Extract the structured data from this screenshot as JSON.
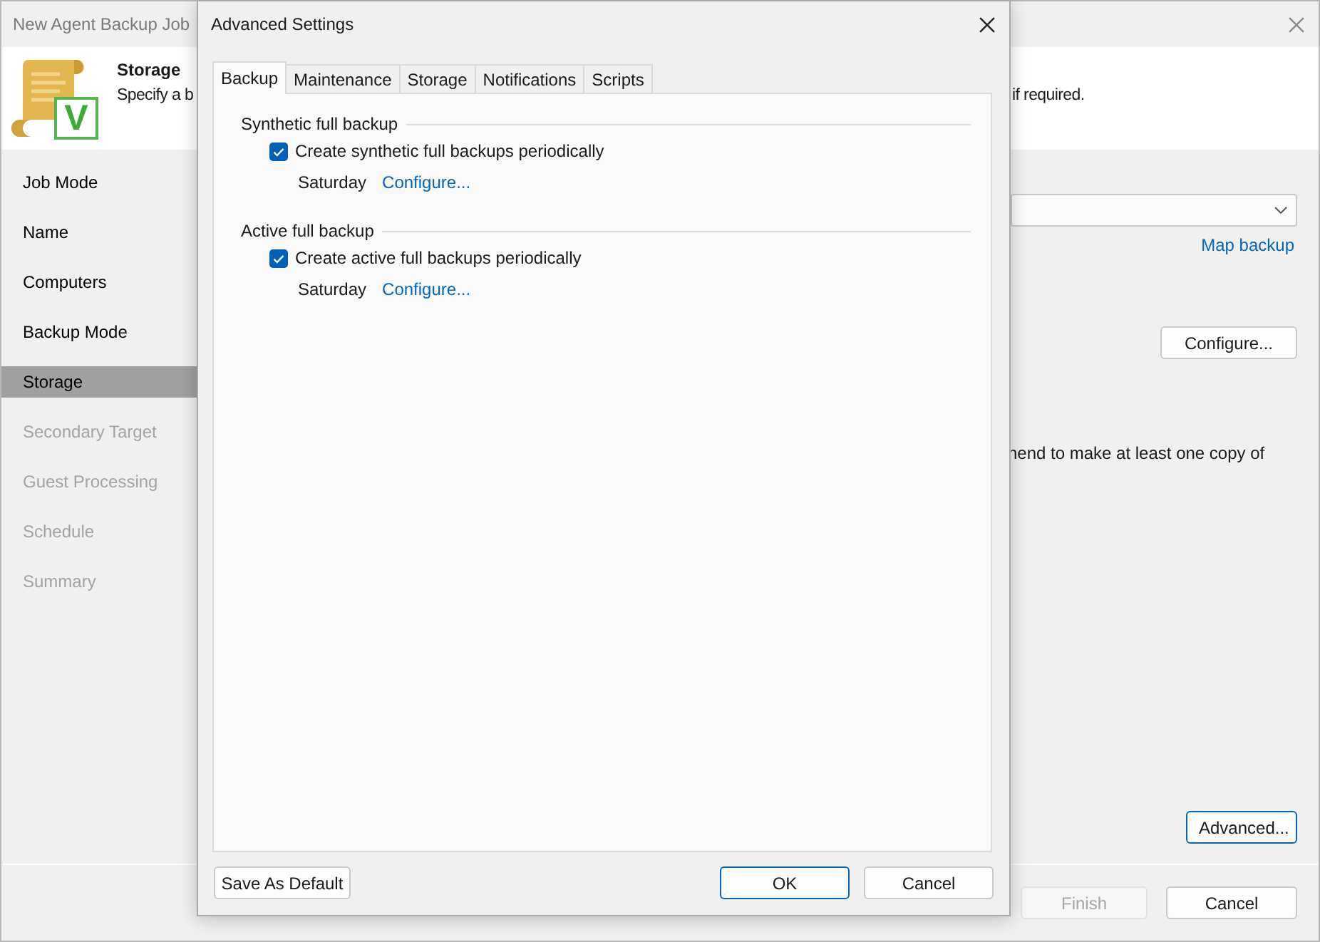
{
  "window": {
    "title": "New Agent Backup Job"
  },
  "header": {
    "title": "Storage",
    "description_start": "Specify a b",
    "description_end": "if required.",
    "badge": "V"
  },
  "sidebar": {
    "items": [
      {
        "label": "Job Mode",
        "selected": false,
        "disabled": false
      },
      {
        "label": "Name",
        "selected": false,
        "disabled": false
      },
      {
        "label": "Computers",
        "selected": false,
        "disabled": false
      },
      {
        "label": "Backup Mode",
        "selected": false,
        "disabled": false
      },
      {
        "label": "Storage",
        "selected": true,
        "disabled": false
      },
      {
        "label": "Secondary Target",
        "selected": false,
        "disabled": true
      },
      {
        "label": "Guest Processing",
        "selected": false,
        "disabled": true
      },
      {
        "label": "Schedule",
        "selected": false,
        "disabled": true
      },
      {
        "label": "Summary",
        "selected": false,
        "disabled": true
      }
    ]
  },
  "content": {
    "map_link": "Map backup",
    "configure_button": {
      "label": "Configure...",
      "focused": false
    },
    "note": "nend to make at least one copy of",
    "advanced_button": {
      "label": "Advanced...",
      "focused": true
    }
  },
  "footer": {
    "buttons": [
      {
        "label": "Finish",
        "disabled": true
      },
      {
        "label": "Cancel",
        "disabled": false
      }
    ]
  },
  "dialog": {
    "title": "Advanced Settings",
    "tabs": [
      {
        "label": "Backup",
        "selected": true
      },
      {
        "label": "Maintenance",
        "selected": false
      },
      {
        "label": "Storage",
        "selected": false
      },
      {
        "label": "Notifications",
        "selected": false
      },
      {
        "label": "Scripts",
        "selected": false
      }
    ],
    "groups": [
      {
        "title": "Synthetic full backup",
        "checkbox": {
          "label": "Create synthetic full backups periodically",
          "checked": true
        },
        "schedule": "Saturday",
        "link": "Configure..."
      },
      {
        "title": "Active full backup",
        "checkbox": {
          "label": "Create active full backups periodically",
          "checked": true
        },
        "schedule": "Saturday",
        "link": "Configure..."
      }
    ],
    "save_default_button": "Save As Default",
    "buttons": [
      {
        "label": "OK",
        "default": true
      },
      {
        "label": "Cancel",
        "default": false
      }
    ]
  }
}
